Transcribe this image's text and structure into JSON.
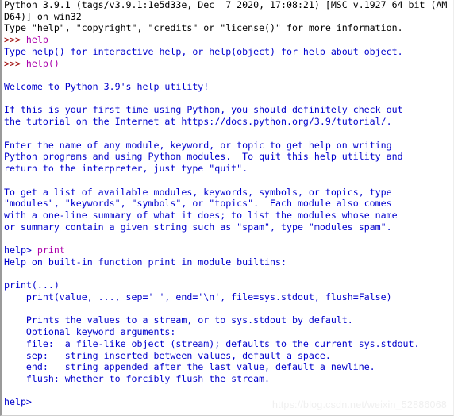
{
  "window": {
    "kind": "python-idle-shell",
    "title": "Python 3.9.1 Shell",
    "background_color": "#ffffff"
  },
  "colors": {
    "banner_text": "#000000",
    "output_text": "#0000cc",
    "prompt": "#9b0000",
    "user_input": "#aa00aa",
    "watermark": "#f0f0f0",
    "border": "#9a9a9a"
  },
  "prompts": {
    "interpreter": ">>> ",
    "help": "help> "
  },
  "watermark": {
    "text": "https://blog.csdn.net/weixin_52886068"
  },
  "lines": [
    {
      "kind": "banner",
      "text": "Python 3.9.1 (tags/v3.9.1:1e5d33e, Dec  7 2020, 17:08:21) [MSC v.1927 64 bit (AM"
    },
    {
      "kind": "banner",
      "text": "D64)] on win32"
    },
    {
      "kind": "banner",
      "text": "Type \"help\", \"copyright\", \"credits\" or \"license()\" for more information."
    },
    {
      "kind": "prompt",
      "prompt": ">>> ",
      "input": "help"
    },
    {
      "kind": "output",
      "text": "Type help() for interactive help, or help(object) for help about object."
    },
    {
      "kind": "prompt",
      "prompt": ">>> ",
      "input": "help()"
    },
    {
      "kind": "output",
      "text": ""
    },
    {
      "kind": "output",
      "text": "Welcome to Python 3.9's help utility!"
    },
    {
      "kind": "output",
      "text": ""
    },
    {
      "kind": "output",
      "text": "If this is your first time using Python, you should definitely check out"
    },
    {
      "kind": "output",
      "text": "the tutorial on the Internet at https://docs.python.org/3.9/tutorial/."
    },
    {
      "kind": "output",
      "text": ""
    },
    {
      "kind": "output",
      "text": "Enter the name of any module, keyword, or topic to get help on writing"
    },
    {
      "kind": "output",
      "text": "Python programs and using Python modules.  To quit this help utility and"
    },
    {
      "kind": "output",
      "text": "return to the interpreter, just type \"quit\"."
    },
    {
      "kind": "output",
      "text": ""
    },
    {
      "kind": "output",
      "text": "To get a list of available modules, keywords, symbols, or topics, type"
    },
    {
      "kind": "output",
      "text": "\"modules\", \"keywords\", \"symbols\", or \"topics\".  Each module also comes"
    },
    {
      "kind": "output",
      "text": "with a one-line summary of what it does; to list the modules whose name"
    },
    {
      "kind": "output",
      "text": "or summary contain a given string such as \"spam\", type \"modules spam\"."
    },
    {
      "kind": "output",
      "text": ""
    },
    {
      "kind": "prompt",
      "prompt": "help> ",
      "input": "print",
      "prompt_color": "output"
    },
    {
      "kind": "output",
      "text": "Help on built-in function print in module builtins:"
    },
    {
      "kind": "output",
      "text": ""
    },
    {
      "kind": "output",
      "text": "print(...)"
    },
    {
      "kind": "output",
      "text": "    print(value, ..., sep=' ', end='\\n', file=sys.stdout, flush=False)"
    },
    {
      "kind": "output",
      "text": ""
    },
    {
      "kind": "output",
      "text": "    Prints the values to a stream, or to sys.stdout by default."
    },
    {
      "kind": "output",
      "text": "    Optional keyword arguments:"
    },
    {
      "kind": "output",
      "text": "    file:  a file-like object (stream); defaults to the current sys.stdout."
    },
    {
      "kind": "output",
      "text": "    sep:   string inserted between values, default a space."
    },
    {
      "kind": "output",
      "text": "    end:   string appended after the last value, default a newline."
    },
    {
      "kind": "output",
      "text": "    flush: whether to forcibly flush the stream."
    },
    {
      "kind": "output",
      "text": ""
    },
    {
      "kind": "prompt_only",
      "prompt": "help>",
      "prompt_color": "output"
    }
  ]
}
